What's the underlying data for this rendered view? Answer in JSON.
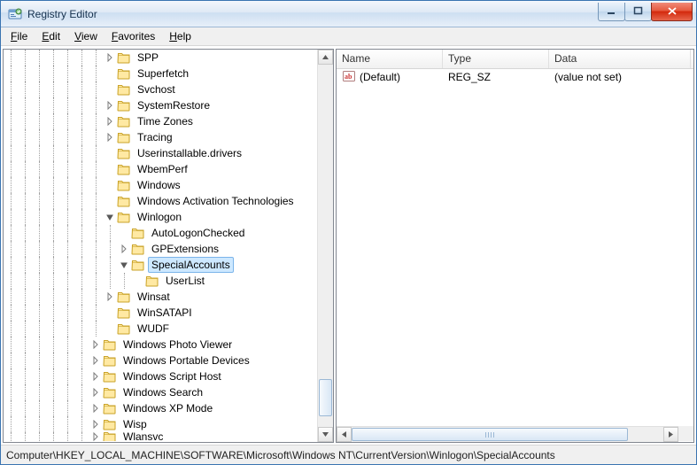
{
  "window": {
    "title": "Registry Editor"
  },
  "menu": {
    "file": "File",
    "edit": "Edit",
    "view": "View",
    "favorites": "Favorites",
    "help": "Help"
  },
  "tree": {
    "guide_depths": 7,
    "items": [
      {
        "depth": 0,
        "exp": "closed",
        "label": "SPP"
      },
      {
        "depth": 0,
        "exp": "none",
        "label": "Superfetch"
      },
      {
        "depth": 0,
        "exp": "none",
        "label": "Svchost"
      },
      {
        "depth": 0,
        "exp": "closed",
        "label": "SystemRestore"
      },
      {
        "depth": 0,
        "exp": "closed",
        "label": "Time Zones"
      },
      {
        "depth": 0,
        "exp": "closed",
        "label": "Tracing"
      },
      {
        "depth": 0,
        "exp": "none",
        "label": "Userinstallable.drivers"
      },
      {
        "depth": 0,
        "exp": "none",
        "label": "WbemPerf"
      },
      {
        "depth": 0,
        "exp": "none",
        "label": "Windows"
      },
      {
        "depth": 0,
        "exp": "none",
        "label": "Windows Activation Technologies"
      },
      {
        "depth": 0,
        "exp": "open",
        "label": "Winlogon"
      },
      {
        "depth": 1,
        "exp": "none",
        "label": "AutoLogonChecked"
      },
      {
        "depth": 1,
        "exp": "closed",
        "label": "GPExtensions"
      },
      {
        "depth": 1,
        "exp": "open",
        "label": "SpecialAccounts",
        "selected": true
      },
      {
        "depth": 2,
        "exp": "none",
        "label": "UserList"
      },
      {
        "depth": 0,
        "exp": "closed",
        "label": "Winsat"
      },
      {
        "depth": 0,
        "exp": "none",
        "label": "WinSATAPI"
      },
      {
        "depth": 0,
        "exp": "none",
        "label": "WUDF"
      },
      {
        "depth": -1,
        "exp": "closed",
        "label": "Windows Photo Viewer"
      },
      {
        "depth": -1,
        "exp": "closed",
        "label": "Windows Portable Devices"
      },
      {
        "depth": -1,
        "exp": "closed",
        "label": "Windows Script Host"
      },
      {
        "depth": -1,
        "exp": "closed",
        "label": "Windows Search"
      },
      {
        "depth": -1,
        "exp": "closed",
        "label": "Windows XP Mode"
      },
      {
        "depth": -1,
        "exp": "closed",
        "label": "Wisp"
      },
      {
        "depth": -1,
        "exp": "closed",
        "label": "Wlansvc",
        "cut": true
      }
    ]
  },
  "list": {
    "cols": [
      {
        "key": "name",
        "label": "Name",
        "width": 120
      },
      {
        "key": "type",
        "label": "Type",
        "width": 120
      },
      {
        "key": "data",
        "label": "Data",
        "width": 160
      }
    ],
    "rows": [
      {
        "icon": "string",
        "name": "(Default)",
        "type": "REG_SZ",
        "data": "(value not set)"
      }
    ]
  },
  "status": {
    "path": "Computer\\HKEY_LOCAL_MACHINE\\SOFTWARE\\Microsoft\\Windows NT\\CurrentVersion\\Winlogon\\SpecialAccounts"
  }
}
